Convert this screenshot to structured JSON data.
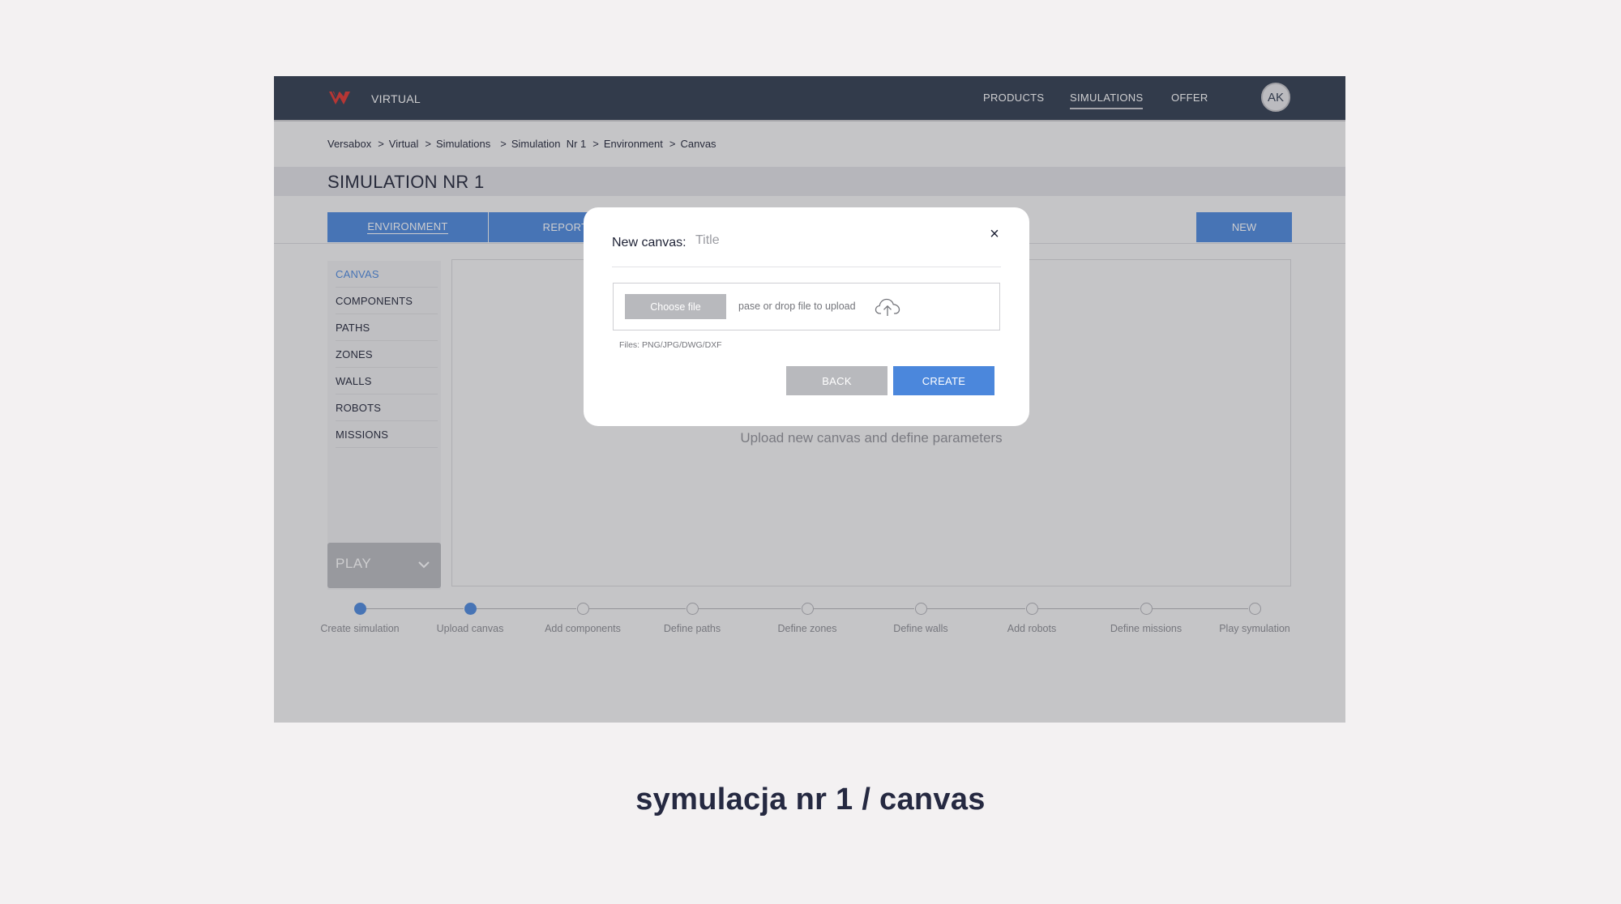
{
  "nav": {
    "brand": "VIRTUAL",
    "links": [
      "PRODUCTS",
      "SIMULATIONS",
      "OFFER"
    ],
    "avatar_initials": "AK"
  },
  "breadcrumb": [
    "Versabox",
    "Virtual",
    "Simulations",
    "Simulation  Nr 1",
    "Environment",
    "Canvas"
  ],
  "page_title": "SIMULATION NR 1",
  "tabs": [
    "ENVIRONMENT",
    "REPORTS"
  ],
  "new_label": "NEW",
  "sidebar": {
    "items": [
      "CANVAS",
      "COMPONENTS",
      "PATHS",
      "ZONES",
      "WALLS",
      "ROBOTS",
      "MISSIONS"
    ],
    "active": "CANVAS",
    "play_label": "PLAY"
  },
  "canvas_hint": "Upload new canvas and define parameters",
  "steps": [
    {
      "label": "Create simulation",
      "done": true
    },
    {
      "label": "Upload canvas",
      "done": true
    },
    {
      "label": "Add components",
      "done": false
    },
    {
      "label": "Define paths",
      "done": false
    },
    {
      "label": "Define zones",
      "done": false
    },
    {
      "label": "Define walls",
      "done": false
    },
    {
      "label": "Add robots",
      "done": false
    },
    {
      "label": "Define missions",
      "done": false
    },
    {
      "label": "Play symulation",
      "done": false
    }
  ],
  "modal": {
    "title_label": "New canvas:",
    "title_placeholder": "Title",
    "close_symbol": "×",
    "choose_file": "Choose file",
    "drop_hint": "pase or drop file to upload",
    "file_types": "Files: PNG/JPG/DWG/DXF",
    "back": "BACK",
    "create": "CREATE"
  },
  "caption": "symulacja nr 1 / canvas",
  "colors": {
    "nav_bg": "#2f3a4e",
    "accent": "#4b87dc",
    "logo_red": "#e0342e",
    "muted_button": "#b8b9bd"
  }
}
